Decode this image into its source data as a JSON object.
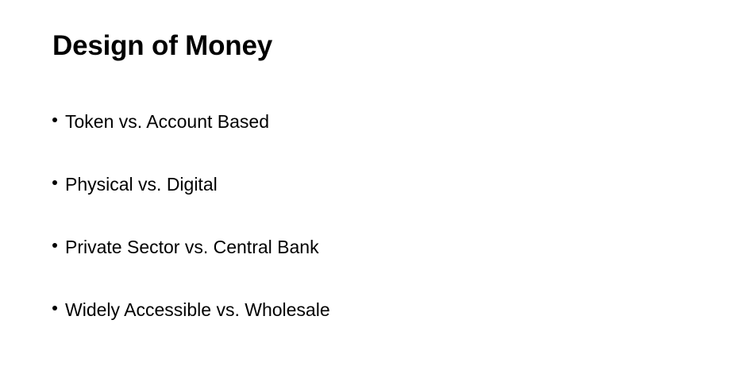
{
  "slide": {
    "title": "Design of Money",
    "bullets": [
      {
        "text": "Token vs. Account Based"
      },
      {
        "text": "Physical vs. Digital"
      },
      {
        "text": "Private Sector vs. Central Bank"
      },
      {
        "text": "Widely Accessible vs. Wholesale"
      }
    ]
  }
}
